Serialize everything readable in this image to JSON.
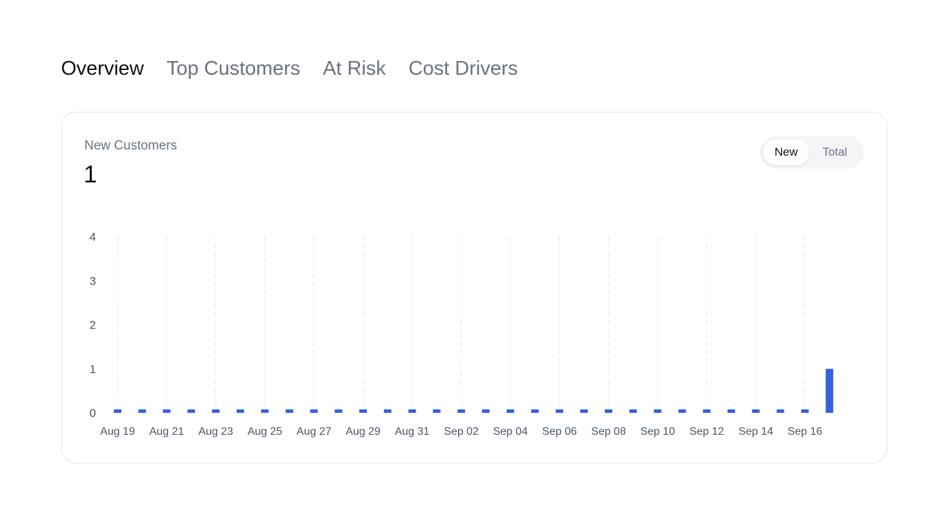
{
  "tabs": [
    {
      "label": "Overview",
      "active": true
    },
    {
      "label": "Top Customers",
      "active": false
    },
    {
      "label": "At Risk",
      "active": false
    },
    {
      "label": "Cost Drivers",
      "active": false
    }
  ],
  "card": {
    "title": "New Customers",
    "value": "1",
    "toggle": {
      "new_label": "New",
      "total_label": "Total",
      "selected": "New"
    }
  },
  "colors": {
    "bar": "#3461e0",
    "grid": "#e5e7eb",
    "tick_text": "#4b5563"
  },
  "chart_data": {
    "type": "bar",
    "title": "New Customers",
    "xlabel": "",
    "ylabel": "",
    "ylim": [
      0,
      4
    ],
    "yticks": [
      0,
      1,
      2,
      3,
      4
    ],
    "grid": "vertical-dashed",
    "x_tick_labels": [
      "Aug 19",
      "Aug 21",
      "Aug 23",
      "Aug 25",
      "Aug 27",
      "Aug 29",
      "Aug 31",
      "Sep 02",
      "Sep 04",
      "Sep 06",
      "Sep 08",
      "Sep 10",
      "Sep 12",
      "Sep 14",
      "Sep 16"
    ],
    "categories": [
      "Aug 19",
      "Aug 20",
      "Aug 21",
      "Aug 22",
      "Aug 23",
      "Aug 24",
      "Aug 25",
      "Aug 26",
      "Aug 27",
      "Aug 28",
      "Aug 29",
      "Aug 30",
      "Aug 31",
      "Sep 01",
      "Sep 02",
      "Sep 03",
      "Sep 04",
      "Sep 05",
      "Sep 06",
      "Sep 07",
      "Sep 08",
      "Sep 09",
      "Sep 10",
      "Sep 11",
      "Sep 12",
      "Sep 13",
      "Sep 14",
      "Sep 15",
      "Sep 16",
      "Sep 17"
    ],
    "values": [
      0,
      0,
      0,
      0,
      0,
      0,
      0,
      0,
      0,
      0,
      0,
      0,
      0,
      0,
      0,
      0,
      0,
      0,
      0,
      0,
      0,
      0,
      0,
      0,
      0,
      0,
      0,
      0,
      0,
      1
    ]
  }
}
